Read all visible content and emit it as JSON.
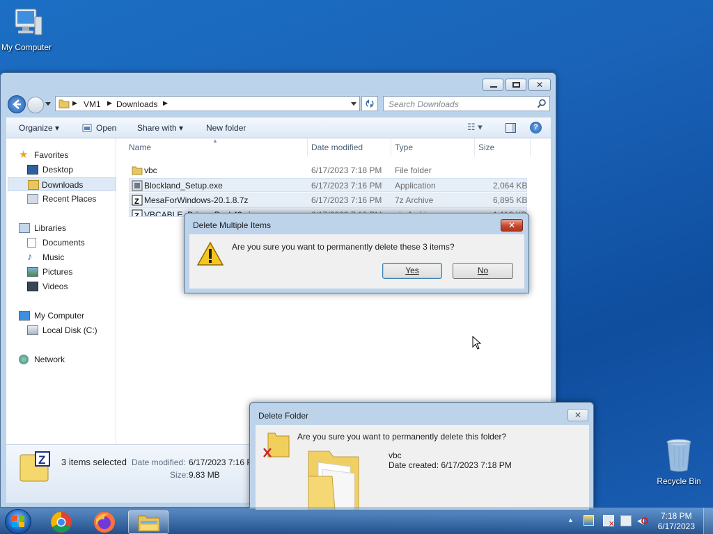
{
  "desktop": {
    "icons": [
      {
        "label": "My Computer"
      },
      {
        "label": "Recycle Bin"
      }
    ]
  },
  "explorer": {
    "breadcrumb": [
      "VM1",
      "Downloads"
    ],
    "search_placeholder": "Search Downloads",
    "toolbar": {
      "organize": "Organize",
      "open": "Open",
      "share_with": "Share with",
      "new_folder": "New folder"
    },
    "nav": {
      "favorites": "Favorites",
      "desktop": "Desktop",
      "downloads": "Downloads",
      "recent_places": "Recent Places",
      "libraries": "Libraries",
      "documents": "Documents",
      "music": "Music",
      "pictures": "Pictures",
      "videos": "Videos",
      "my_computer": "My Computer",
      "local_disk": "Local Disk (C:)",
      "network": "Network"
    },
    "columns": {
      "name": "Name",
      "date": "Date modified",
      "type": "Type",
      "size": "Size"
    },
    "files": [
      {
        "name": "vbc",
        "date": "6/17/2023 7:18 PM",
        "type": "File folder",
        "size": ""
      },
      {
        "name": "Blockland_Setup.exe",
        "date": "6/17/2023 7:16 PM",
        "type": "Application",
        "size": "2,064 KB"
      },
      {
        "name": "MesaForWindows-20.1.8.7z",
        "date": "6/17/2023 7:16 PM",
        "type": "7z Archive",
        "size": "6,895 KB"
      },
      {
        "name": "VBCABLE_Driver_Pack43.zip",
        "date": "6/17/2023 7:18 PM",
        "type": "zip Archive",
        "size": "1,113 KB"
      }
    ],
    "details": {
      "selection": "3 items selected",
      "date_label": "Date modified:",
      "date_value": "6/17/2023 7:16 P",
      "size_label": "Size:",
      "size_value": "9.83 MB"
    }
  },
  "delete_multiple": {
    "title": "Delete Multiple Items",
    "message": "Are you sure you want to permanently delete these 3 items?",
    "yes": "Yes",
    "no": "No"
  },
  "delete_folder": {
    "title": "Delete Folder",
    "message": "Are you sure you want to permanently delete this folder?",
    "folder_name": "vbc",
    "date_created": "Date created: 6/17/2023 7:18 PM"
  },
  "taskbar": {
    "time": "7:18 PM",
    "date": "6/17/2023"
  },
  "colors": {
    "accent": "#3c7fb1",
    "close_red": "#c8462f"
  }
}
